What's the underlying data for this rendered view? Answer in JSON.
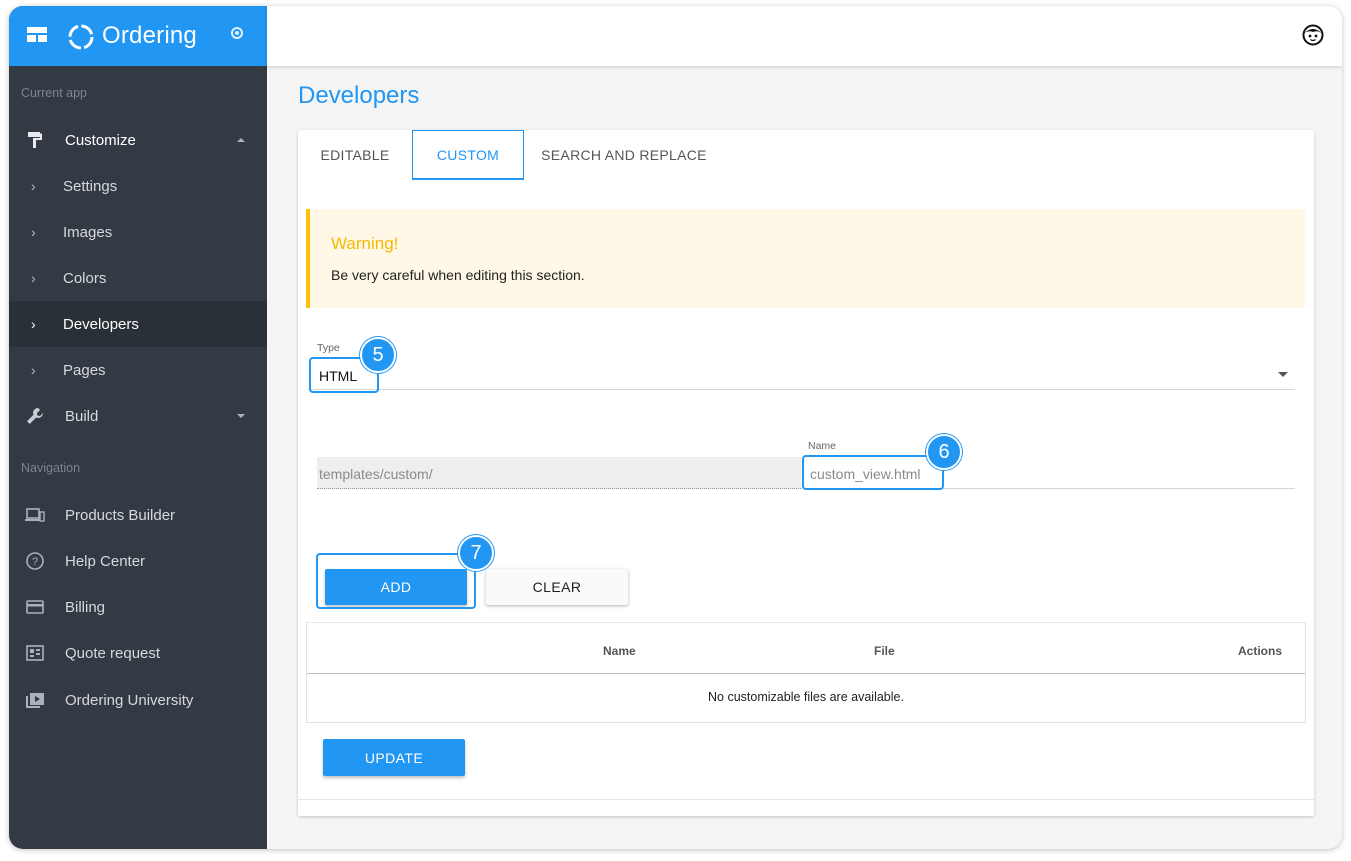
{
  "app": {
    "brand": "Ordering"
  },
  "sidebar": {
    "current_app_label": "Current app",
    "customize": {
      "label": "Customize",
      "icon": "paint-roller-icon"
    },
    "sub_items": [
      {
        "label": "Settings"
      },
      {
        "label": "Images"
      },
      {
        "label": "Colors"
      },
      {
        "label": "Developers",
        "active": true
      },
      {
        "label": "Pages"
      }
    ],
    "build": {
      "label": "Build",
      "icon": "wrench-icon"
    },
    "navigation_label": "Navigation",
    "nav_items": [
      {
        "label": "Products Builder",
        "icon": "devices-icon"
      },
      {
        "label": "Help Center",
        "icon": "help-circle-icon"
      },
      {
        "label": "Billing",
        "icon": "credit-card-icon"
      },
      {
        "label": "Quote request",
        "icon": "quote-icon"
      },
      {
        "label": "Ordering University",
        "icon": "video-library-icon"
      }
    ]
  },
  "page": {
    "title": "Developers"
  },
  "tabs": [
    {
      "label": "EDITABLE"
    },
    {
      "label": "CUSTOM",
      "active": true
    },
    {
      "label": "SEARCH AND REPLACE"
    }
  ],
  "warning": {
    "title": "Warning!",
    "text": "Be very careful when editing this section."
  },
  "form": {
    "type_label": "Type",
    "type_value": "HTML",
    "path_prefix": "templates/custom/",
    "name_label": "Name",
    "name_value": "custom_view.html",
    "add_label": "ADD",
    "clear_label": "CLEAR"
  },
  "table": {
    "columns": [
      "Name",
      "File",
      "Actions"
    ],
    "empty_message": "No customizable files are available."
  },
  "update_label": "UPDATE",
  "callouts": [
    "5",
    "6",
    "7"
  ],
  "colors": {
    "accent": "#2196f3",
    "sidebar": "#333a44",
    "warning_bg": "#fff8e6",
    "warning_accent": "#ffc107"
  }
}
